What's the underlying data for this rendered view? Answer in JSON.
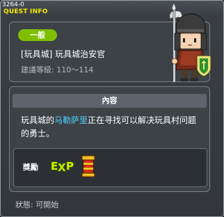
{
  "window": {
    "id": "3264-0",
    "title": "QUEST INFO"
  },
  "quest": {
    "badge": "一般",
    "name": "[玩具城] 玩具城治安官",
    "level": "建議等級: 110～114"
  },
  "content": {
    "header": "內容",
    "text_before": "玩具城的",
    "npc_name": "马勒萨里",
    "text_after": "正在寻找可以解决玩具村问题的勇士。"
  },
  "reward": {
    "label": "獎勵",
    "icons": [
      "exp-icon",
      "item-icon"
    ]
  },
  "status": {
    "text": "狀態:  可開始"
  },
  "colors": {
    "title": "#f4ea00",
    "badge": "#7fbf00",
    "highlight": "#4fd0ff"
  }
}
